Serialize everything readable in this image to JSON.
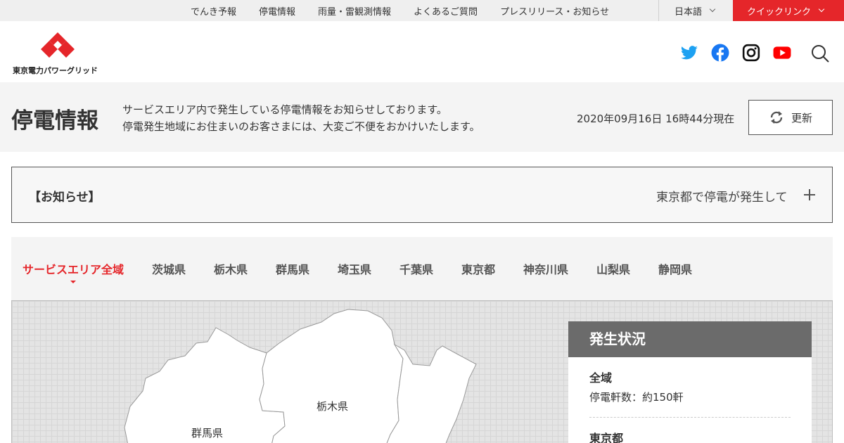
{
  "utility_nav": {
    "links": [
      "でんき予報",
      "停電情報",
      "雨量・雷観測情報",
      "よくあるご質問",
      "プレスリリース・お知らせ"
    ],
    "language": "日本語",
    "quick_link": "クイックリンク"
  },
  "header": {
    "logo_text": "東京電力パワーグリッド",
    "social_icons": [
      "twitter-icon",
      "facebook-icon",
      "instagram-icon",
      "youtube-icon"
    ],
    "colors": {
      "brand_red": "#e5262a",
      "twitter": "#1da1f2",
      "facebook": "#1877f2",
      "youtube": "#ff0000"
    }
  },
  "page": {
    "title": "停電情報",
    "description_line1": "サービスエリア内で発生している停電情報をお知らせしております。",
    "description_line2": "停電発生地域にお住まいのお客さまには、大変ご不便をおかけいたします。",
    "as_of": "2020年09月16日 16時44分現在",
    "refresh_label": "更新"
  },
  "notice": {
    "label": "【お知らせ】",
    "text": "東京都で停電が発生して"
  },
  "tabs": {
    "active_index": 0,
    "items": [
      "サービスエリア全域",
      "茨城県",
      "栃木県",
      "群馬県",
      "埼玉県",
      "千葉県",
      "東京都",
      "神奈川県",
      "山梨県",
      "静岡県"
    ]
  },
  "map": {
    "labels": {
      "tochigi": "栃木県",
      "gunma": "群馬県"
    }
  },
  "status_panel": {
    "title": "発生状況",
    "regions": [
      {
        "name": "全域",
        "count": "停電軒数：約150軒"
      },
      {
        "name": "東京都",
        "count": ""
      }
    ]
  }
}
